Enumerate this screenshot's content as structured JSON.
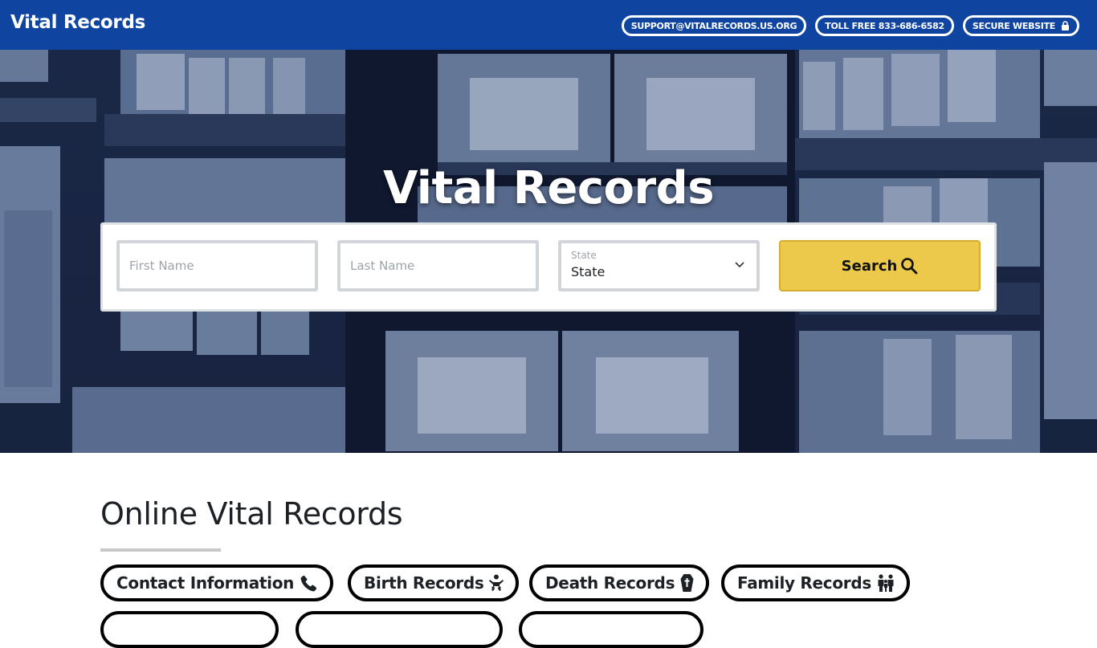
{
  "header": {
    "brand": "Vital Records",
    "pills": [
      {
        "label": "SUPPORT@VITALRECORDS.US.ORG",
        "icon": null
      },
      {
        "label": "TOLL FREE 833-686-6582",
        "icon": null
      },
      {
        "label": "SECURE WEBSITE",
        "icon": "lock-icon"
      }
    ]
  },
  "hero": {
    "title": "Vital Records",
    "search": {
      "first_name": {
        "placeholder": "First Name",
        "value": ""
      },
      "last_name": {
        "placeholder": "Last Name",
        "value": ""
      },
      "state": {
        "label": "State",
        "selected": "State"
      },
      "button_label": "Search"
    }
  },
  "section": {
    "title": "Online Vital Records",
    "categories": [
      {
        "label": "Contact Information",
        "icon": "phone-icon"
      },
      {
        "label": "Birth Records",
        "icon": "baby-icon"
      },
      {
        "label": "Death Records",
        "icon": "coffin-icon"
      },
      {
        "label": "Family Records",
        "icon": "family-icon"
      }
    ]
  },
  "colors": {
    "header_bg": "#0f45a0",
    "search_button": "#ecc94b",
    "text_dark": "#1d2125"
  }
}
